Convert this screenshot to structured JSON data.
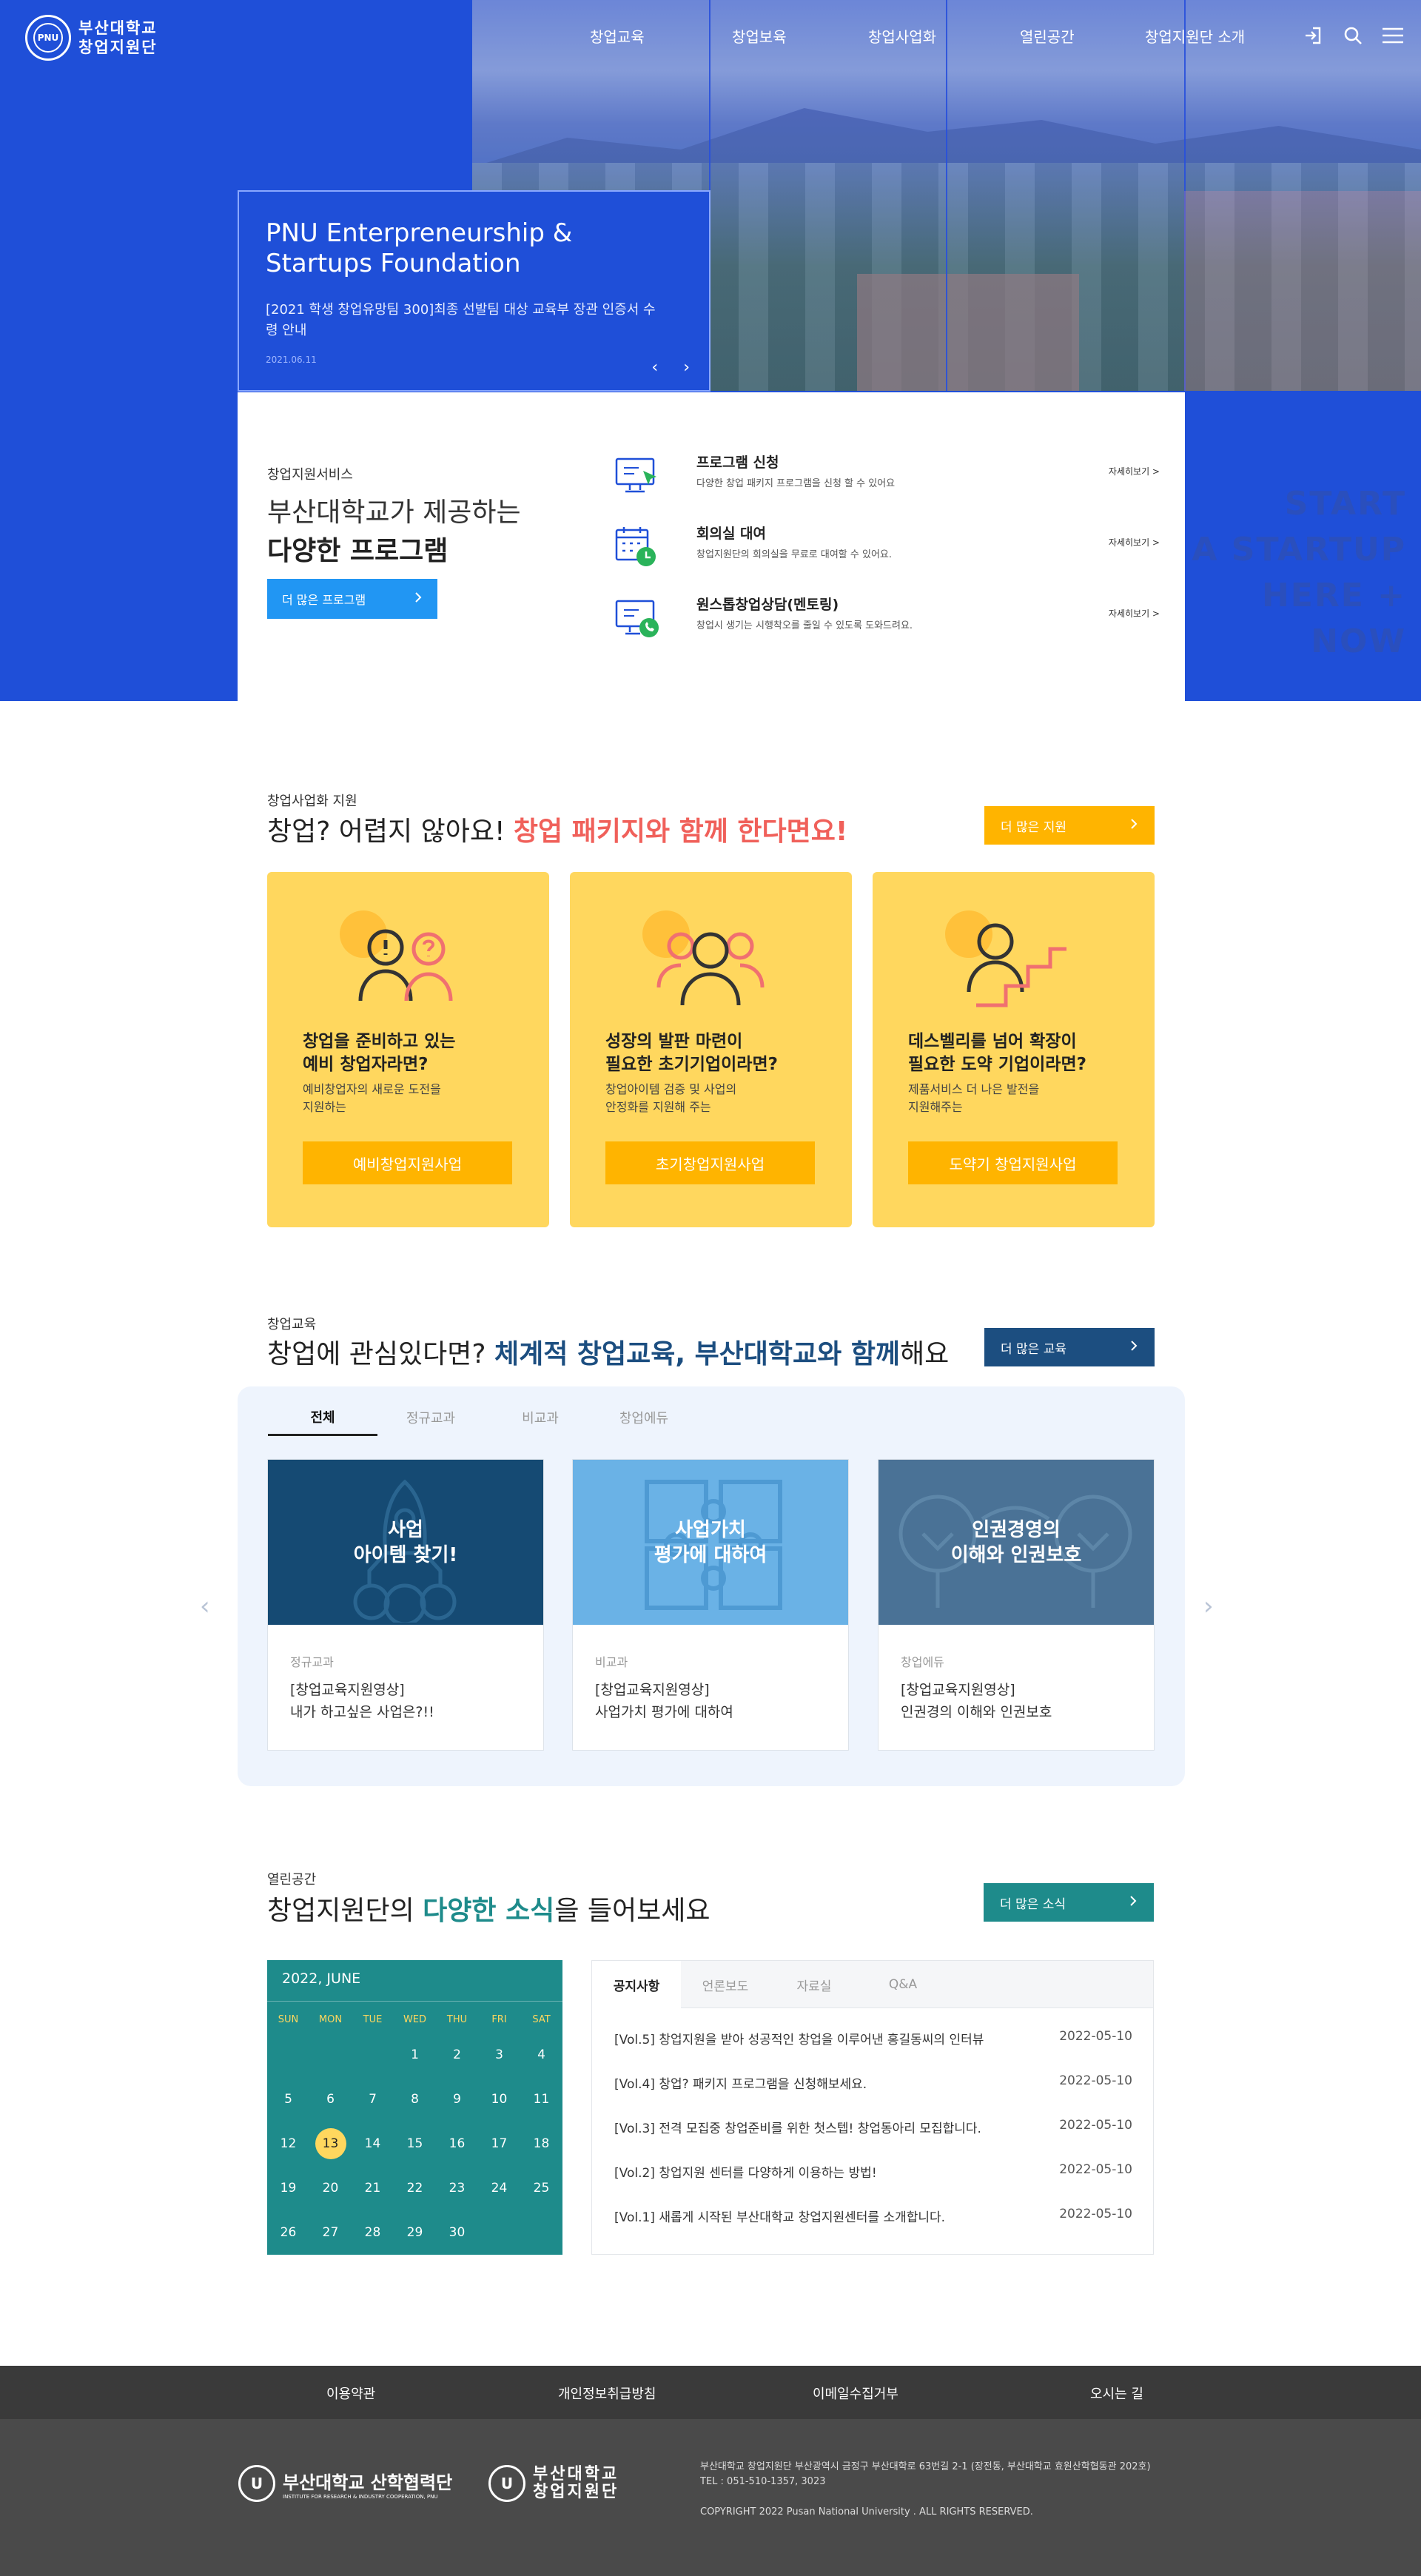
{
  "brand": {
    "logo_line1": "부산대학교",
    "logo_line2": "창업지원단",
    "seal_text": "PNU"
  },
  "nav": [
    "창업교육",
    "창업보육",
    "창업사업화",
    "열린공간",
    "창업지원단 소개"
  ],
  "hero": {
    "title_line1": "PNU Enterpreneurship &",
    "title_line2": "Startups Foundation",
    "news_text": "[2021 학생 창업유망팀 300]최종 선발팀 대상 교육부 장관 인증서 수령 안내",
    "date": "2021.06.11",
    "prev": "‹",
    "next": "›"
  },
  "program": {
    "eyebrow": "창업지원서비스",
    "title1": "부산대학교가 제공하는",
    "title2": "다양한 프로그램",
    "button": "더 많은 프로그램",
    "items": [
      {
        "name": "프로그램 신청",
        "desc": "다양한 창업 패키지 프로그램을 신청 할 수 있어요",
        "more": "자세히보기 >"
      },
      {
        "name": "회의실 대여",
        "desc": "창업지원단의 회의실을 무료로 대여할 수 있어요.",
        "more": "자세히보기 >"
      },
      {
        "name": "원스톱창업상담(멘토링)",
        "desc": "창업시 생기는 시행착오를 줄일 수 있도록 도와드려요.",
        "more": "자세히보기 >"
      }
    ],
    "start_text": [
      "START",
      "A STARTUP",
      "HERE + NOW"
    ]
  },
  "package": {
    "eyebrow": "창업사업화 지원",
    "title_plain": "창업? 어렵지 않아요! ",
    "title_accent": "창업 패키지와 함께 한다면요!",
    "button": "더 많은 지원",
    "cards": [
      {
        "title1": "창업을 준비하고 있는",
        "title2": "예비 창업자라면?",
        "desc1": "예비창업자의 새로운 도전을",
        "desc2": "지원하는",
        "button": "예비창업지원사업"
      },
      {
        "title1": "성장의 발판 마련이",
        "title2": "필요한 초기기업이라면?",
        "desc1": "창업아이템 검증 및 사업의",
        "desc2": "안정화를 지원해 주는",
        "button": "초기창업지원사업"
      },
      {
        "title1": "데스벨리를 넘어 확장이",
        "title2": "필요한 도약 기업이라면?",
        "desc1": "제품서비스 더 나은 발전을",
        "desc2": "지원해주는",
        "button": "도약기 창업지원사업"
      }
    ]
  },
  "education": {
    "eyebrow": "창업교육",
    "title_a": "창업에 관심있다면? ",
    "title_b": "체계적 창업교육, ",
    "title_c": "부산대학교와 함께",
    "title_d": "해요",
    "button": "더 많은 교육",
    "tabs": [
      "전체",
      "정규교과",
      "비교과",
      "창업에듀"
    ],
    "cards": [
      {
        "thumb1": "사업",
        "thumb2": "아이템 찾기!",
        "category": "정규교과",
        "line1": "[창업교육지원영상]",
        "line2": "내가 하고싶은 사업은?!!"
      },
      {
        "thumb1": "사업가치",
        "thumb2": "평가에 대하여",
        "category": "비교과",
        "line1": "[창업교육지원영상]",
        "line2": "사업가치 평가에 대하여"
      },
      {
        "thumb1": "인권경영의",
        "thumb2": "이해와 인권보호",
        "category": "창업에듀",
        "line1": "[창업교육지원영상]",
        "line2": "인권경의 이해와 인권보호"
      }
    ],
    "prev": "‹",
    "next": "›"
  },
  "news": {
    "eyebrow": "열린공간",
    "title_a": "창업지원단의 ",
    "title_b": "다양한 소식",
    "title_c": "을 들어보세요",
    "button": "더 많은 소식",
    "tabs": [
      "공지사항",
      "언론보도",
      "자료실",
      "Q&A"
    ],
    "items": [
      {
        "title": "[Vol.5] 창업지원을 받아 성공적인 창업을 이루어낸 홍길동씨의 인터뷰",
        "date": "2022-05-10"
      },
      {
        "title": "[Vol.4] 창업? 패키지 프로그램을 신청해보세요.",
        "date": "2022-05-10"
      },
      {
        "title": "[Vol.3] 전격 모집중 창업준비를 위한 첫스텝! 창업동아리 모집합니다.",
        "date": "2022-05-10"
      },
      {
        "title": "[Vol.2] 창업지원 센터를 다양하게 이용하는 방법!",
        "date": "2022-05-10"
      },
      {
        "title": "[Vol.1] 새롭게 시작된 부산대학교 창업지원센터를 소개합니다.",
        "date": "2022-05-10"
      }
    ]
  },
  "calendar": {
    "month": "2022, JUNE",
    "days": [
      "SUN",
      "MON",
      "TUE",
      "WED",
      "THU",
      "FRI",
      "SAT"
    ],
    "weeks": [
      [
        "",
        "",
        "",
        "1",
        "2",
        "3",
        "4"
      ],
      [
        "5",
        "6",
        "7",
        "8",
        "9",
        "10",
        "11"
      ],
      [
        "12",
        "13",
        "14",
        "15",
        "16",
        "17",
        "18"
      ],
      [
        "19",
        "20",
        "21",
        "22",
        "23",
        "24",
        "25"
      ],
      [
        "26",
        "27",
        "28",
        "29",
        "30",
        "",
        ""
      ]
    ],
    "today": "13"
  },
  "footer": {
    "links": [
      "이용약관",
      "개인정보취급방침",
      "이메일수집거부",
      "오시는 길"
    ],
    "org1_name": "부산대학교 산학협력단",
    "org1_sub": "INSTITUTE FOR RESEARCH & INDUSTRY COOPERATION, PNU",
    "org2_line1": "부산대학교",
    "org2_line2": "창업지원단",
    "address": "부산대학교 창업지원단   부산광역시 금정구 부산대학로 63번길 2-1 (장전동, 부산대학교 효원산학협동관 202호)",
    "tel": "TEL : 051-510-1357, 3023",
    "copyright": "COPYRIGHT 2022 Pusan National University . ALL RIGHTS RESERVED."
  },
  "colors": {
    "primary_blue": "#1f4fd8",
    "sky": "#2196f3",
    "yellow": "#ffd75e",
    "orange": "#ffb400",
    "teal": "#1e8b8b",
    "navy": "#1c4e80",
    "coral": "#f0605a"
  }
}
